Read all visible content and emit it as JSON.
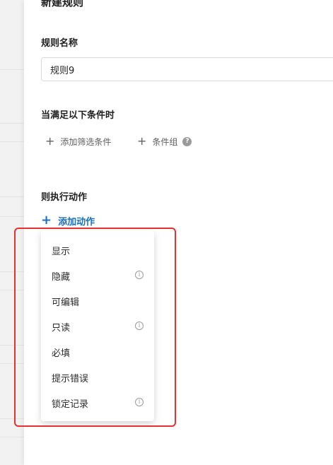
{
  "panel": {
    "title": "新建规则",
    "rule_name_label": "规则名称",
    "rule_name_value": "规则9",
    "condition_label": "当满足以下条件时",
    "add_filter_label": "添加筛选条件",
    "condition_group_label": "条件组",
    "action_label": "则执行动作",
    "add_action_label": "添加动作"
  },
  "icons": {
    "plus": "plus-icon",
    "help": "question-circle-icon",
    "info": "info-circle-icon"
  },
  "action_menu": {
    "items": [
      {
        "label": "显示",
        "has_info": false
      },
      {
        "label": "隐藏",
        "has_info": true
      },
      {
        "label": "可编辑",
        "has_info": false
      },
      {
        "label": "只读",
        "has_info": true
      },
      {
        "label": "必填",
        "has_info": false
      },
      {
        "label": "提示错误",
        "has_info": false
      },
      {
        "label": "锁定记录",
        "has_info": true
      }
    ]
  },
  "colors": {
    "accent": "#1a6fc2",
    "highlight": "#e8302e",
    "text": "#1f1f1f",
    "muted": "#5f5f5f"
  }
}
